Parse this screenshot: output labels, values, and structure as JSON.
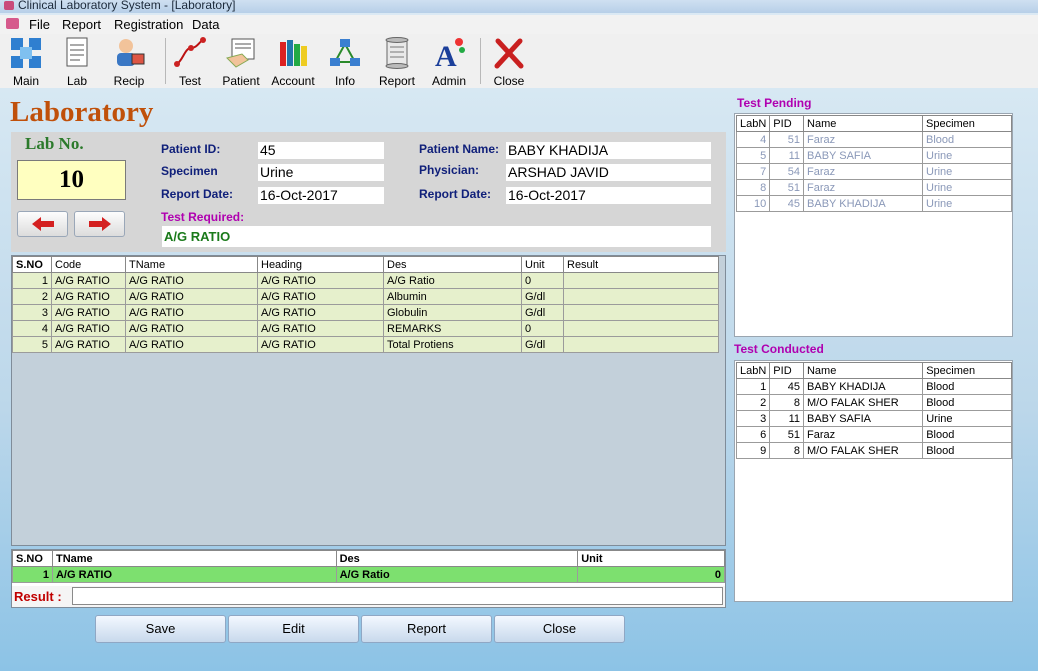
{
  "window": {
    "title": "Clinical Laboratory System - [Laboratory]"
  },
  "menu": [
    "File",
    "Report",
    "Registration",
    "Data"
  ],
  "toolbar": [
    {
      "label": "Main",
      "icon": "main-grid-icon"
    },
    {
      "label": "Lab",
      "icon": "lab-document-icon"
    },
    {
      "label": "Recip",
      "icon": "receptionist-icon"
    },
    {
      "label": "Test",
      "icon": "test-curve-icon"
    },
    {
      "label": "Patient",
      "icon": "patient-hand-icon"
    },
    {
      "label": "Account",
      "icon": "account-books-icon"
    },
    {
      "label": "Info",
      "icon": "info-network-icon"
    },
    {
      "label": "Report",
      "icon": "report-scroll-icon"
    },
    {
      "label": "Admin",
      "icon": "admin-letter-icon"
    },
    {
      "label": "Close",
      "icon": "close-x-icon"
    }
  ],
  "page_title": "Laboratory",
  "lab_no": {
    "label": "Lab No.",
    "value": "10"
  },
  "patient": {
    "id_label": "Patient ID:",
    "id": "45",
    "specimen_label": "Specimen",
    "specimen": "Urine",
    "report_date_label": "Report Date:",
    "report_date": "16-Oct-2017",
    "name_label": "Patient Name:",
    "name": "BABY KHADIJA",
    "physician_label": "Physician:",
    "physician": "ARSHAD JAVID",
    "report_date2_label": "Report Date:",
    "report_date2": "16-Oct-2017"
  },
  "test_required": {
    "label": "Test Required:",
    "value": "A/G RATIO"
  },
  "main_grid": {
    "columns": [
      "S.NO",
      "Code",
      "TName",
      "Heading",
      "Des",
      "Unit",
      "Result"
    ],
    "rows": [
      [
        "1",
        "A/G RATIO",
        "A/G RATIO",
        "A/G RATIO",
        "A/G Ratio",
        "0",
        ""
      ],
      [
        "2",
        "A/G RATIO",
        "A/G RATIO",
        "A/G RATIO",
        "Albumin",
        "G/dl",
        ""
      ],
      [
        "3",
        "A/G RATIO",
        "A/G RATIO",
        "A/G RATIO",
        "Globulin",
        "G/dl",
        ""
      ],
      [
        "4",
        "A/G RATIO",
        "A/G RATIO",
        "A/G RATIO",
        "REMARKS",
        "0",
        ""
      ],
      [
        "5",
        "A/G RATIO",
        "A/G RATIO",
        "A/G RATIO",
        "Total Protiens",
        "G/dl",
        ""
      ]
    ]
  },
  "summary_grid": {
    "columns": [
      "S.NO",
      "TName",
      "Des",
      "Unit"
    ],
    "rows": [
      [
        "1",
        "A/G RATIO",
        "A/G Ratio",
        "0"
      ]
    ]
  },
  "result": {
    "label": "Result :",
    "value": ""
  },
  "buttons": {
    "save": "Save",
    "edit": "Edit",
    "report": "Report",
    "close": "Close"
  },
  "test_pending": {
    "title": "Test Pending",
    "columns": [
      "LabN",
      "PID",
      "Name",
      "Specimen"
    ],
    "rows": [
      [
        "4",
        "51",
        "Faraz",
        "Blood"
      ],
      [
        "5",
        "11",
        "BABY SAFIA",
        "Urine"
      ],
      [
        "7",
        "54",
        "Faraz",
        "Urine"
      ],
      [
        "8",
        "51",
        "Faraz",
        "Urine"
      ],
      [
        "10",
        "45",
        "BABY KHADIJA",
        "Urine"
      ]
    ]
  },
  "test_conducted": {
    "title": "Test Conducted",
    "columns": [
      "LabN",
      "PID",
      "Name",
      "Specimen"
    ],
    "rows": [
      [
        "1",
        "45",
        "BABY KHADIJA",
        "Blood"
      ],
      [
        "2",
        "8",
        "M/O FALAK SHER",
        "Blood"
      ],
      [
        "3",
        "11",
        "BABY SAFIA",
        "Urine"
      ],
      [
        "6",
        "51",
        "Faraz",
        "Blood"
      ],
      [
        "9",
        "8",
        "M/O FALAK SHER",
        "Blood"
      ]
    ]
  }
}
